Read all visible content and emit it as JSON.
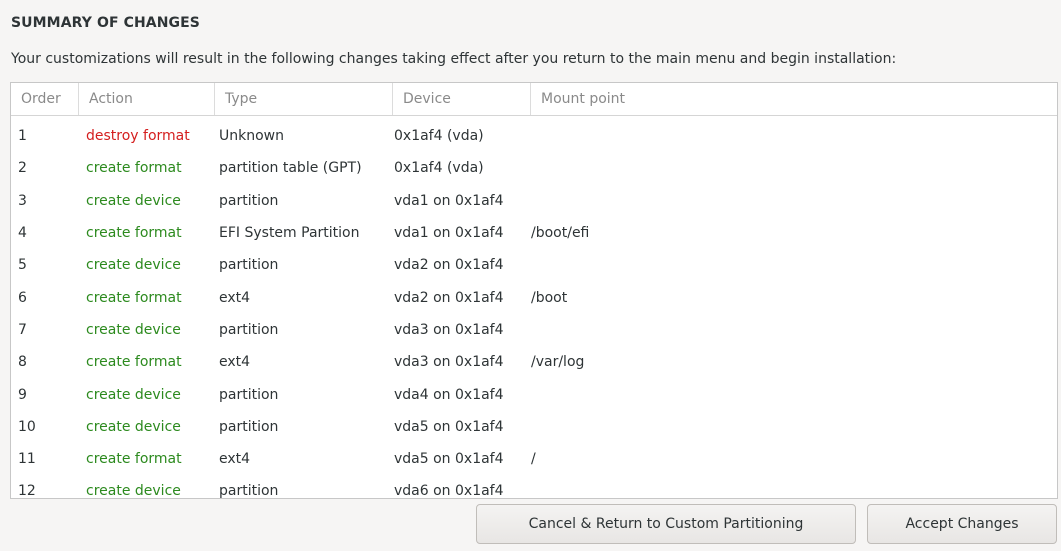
{
  "summary": {
    "title": "SUMMARY OF CHANGES",
    "description": "Your customizations will result in the following changes taking effect after you return to the main menu and begin installation:"
  },
  "table": {
    "headers": {
      "order": "Order",
      "action": "Action",
      "type": "Type",
      "device": "Device",
      "mount": "Mount point"
    },
    "rows": [
      {
        "order": "1",
        "action": "destroy format",
        "type": "Unknown",
        "device": "0x1af4 (vda)",
        "mount": ""
      },
      {
        "order": "2",
        "action": "create format",
        "type": "partition table (GPT)",
        "device": "0x1af4 (vda)",
        "mount": ""
      },
      {
        "order": "3",
        "action": "create device",
        "type": "partition",
        "device": "vda1 on 0x1af4",
        "mount": ""
      },
      {
        "order": "4",
        "action": "create format",
        "type": "EFI System Partition",
        "device": "vda1 on 0x1af4",
        "mount": "/boot/efi"
      },
      {
        "order": "5",
        "action": "create device",
        "type": "partition",
        "device": "vda2 on 0x1af4",
        "mount": ""
      },
      {
        "order": "6",
        "action": "create format",
        "type": "ext4",
        "device": "vda2 on 0x1af4",
        "mount": "/boot"
      },
      {
        "order": "7",
        "action": "create device",
        "type": "partition",
        "device": "vda3 on 0x1af4",
        "mount": ""
      },
      {
        "order": "8",
        "action": "create format",
        "type": "ext4",
        "device": "vda3 on 0x1af4",
        "mount": "/var/log"
      },
      {
        "order": "9",
        "action": "create device",
        "type": "partition",
        "device": "vda4 on 0x1af4",
        "mount": ""
      },
      {
        "order": "10",
        "action": "create device",
        "type": "partition",
        "device": "vda5 on 0x1af4",
        "mount": ""
      },
      {
        "order": "11",
        "action": "create format",
        "type": "ext4",
        "device": "vda5 on 0x1af4",
        "mount": "/"
      },
      {
        "order": "12",
        "action": "create device",
        "type": "partition",
        "device": "vda6 on 0x1af4",
        "mount": ""
      }
    ]
  },
  "buttons": {
    "cancel": "Cancel & Return to Custom Partitioning",
    "accept": "Accept Changes"
  },
  "colors": {
    "destroy": "#d41e1e",
    "create": "#2c8a1e"
  }
}
